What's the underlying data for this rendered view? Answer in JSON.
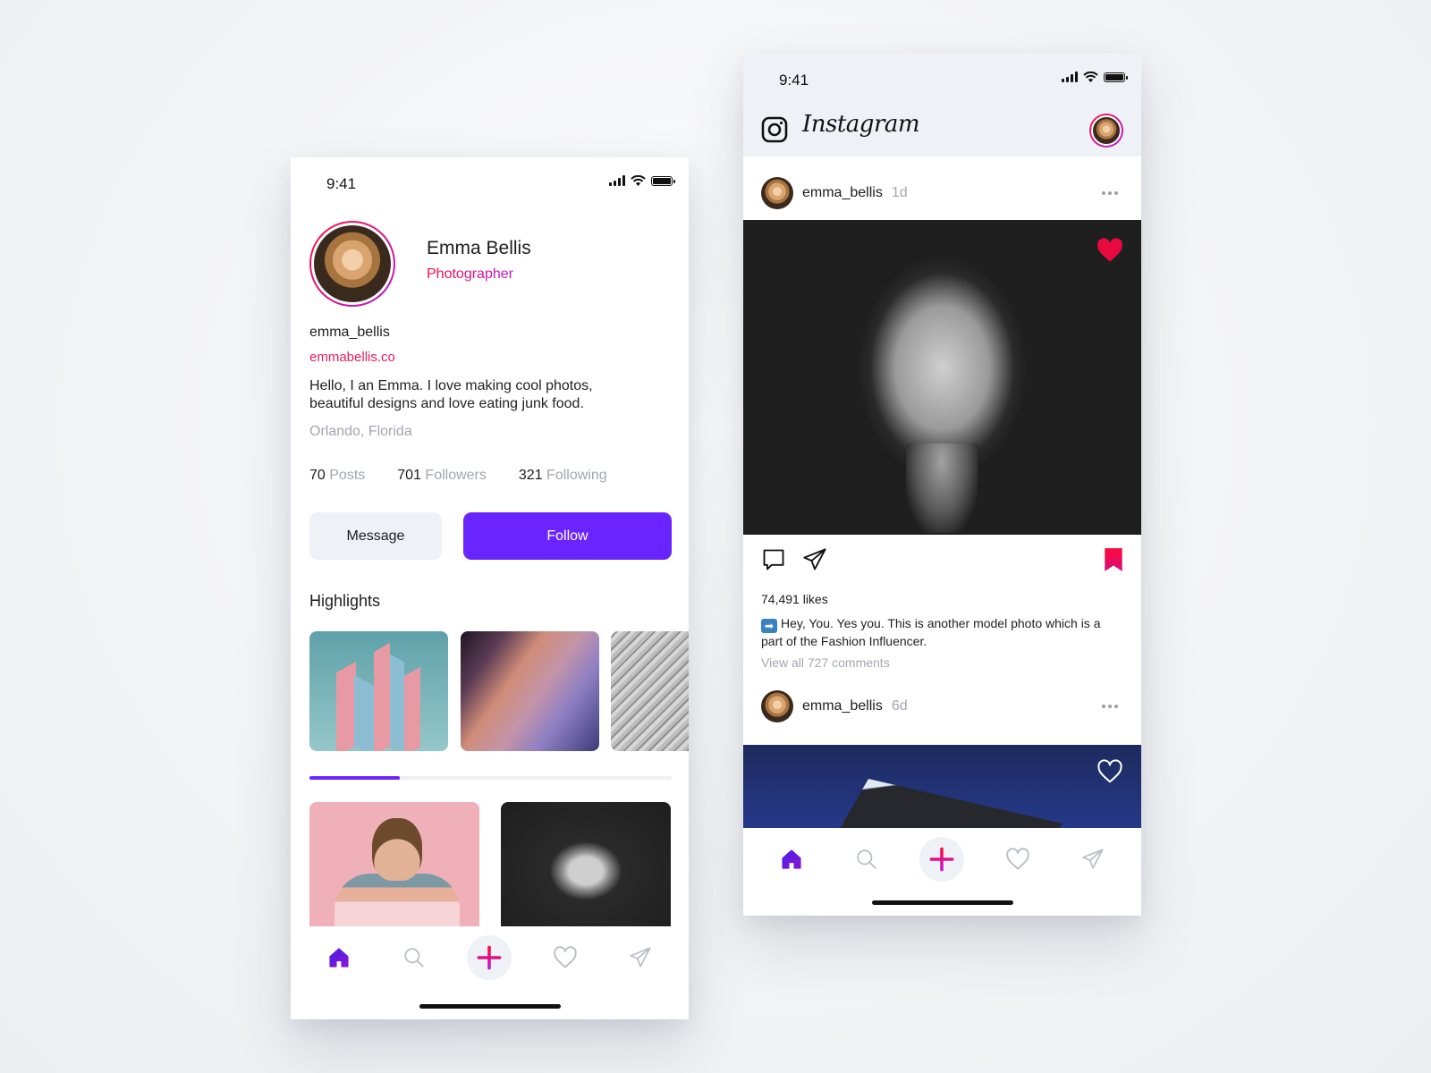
{
  "profile_screen": {
    "status_bar": {
      "time": "9:41"
    },
    "name": "Emma Bellis",
    "role": "Photographer",
    "username": "emma_bellis",
    "website": "emmabellis.co",
    "bio": "Hello, I an Emma. I love making cool photos, beautiful designs and love eating junk food.",
    "location": "Orlando, Florida",
    "stats": [
      {
        "value": "70",
        "label": "Posts"
      },
      {
        "value": "701",
        "label": "Followers"
      },
      {
        "value": "321",
        "label": "Following"
      }
    ],
    "buttons": {
      "message": "Message",
      "follow": "Follow"
    },
    "highlights_title": "Highlights",
    "highlights": [
      "architecture-pink-blue",
      "canyon-purple",
      "gray-waves"
    ],
    "highlights_scroll_progress": 0.25,
    "grid_photos": [
      "man-tattoo-pink",
      "woman-bw-portrait"
    ]
  },
  "feed_screen": {
    "status_bar": {
      "time": "9:41"
    },
    "app_title": "Instagram",
    "posts": [
      {
        "username": "emma_bellis",
        "time": "1d",
        "liked": true,
        "saved": true,
        "likes": "74,491 likes",
        "caption": "Hey, You. Yes you. This is another model photo which is a part of the Fashion Influencer.",
        "caption_emoji": "➡",
        "comments_link": "View all 727 comments"
      },
      {
        "username": "emma_bellis",
        "time": "6d",
        "liked": false
      }
    ]
  },
  "bottom_nav": {
    "items": [
      "home",
      "search",
      "add",
      "activity",
      "direct"
    ],
    "active": "home"
  },
  "colors": {
    "accent_purple": "#6a24fe",
    "accent_pink": "#ea1d5d",
    "heart_red": "#e8093f",
    "muted_text": "#a3a6ad",
    "light_bg": "#eef1f5"
  }
}
